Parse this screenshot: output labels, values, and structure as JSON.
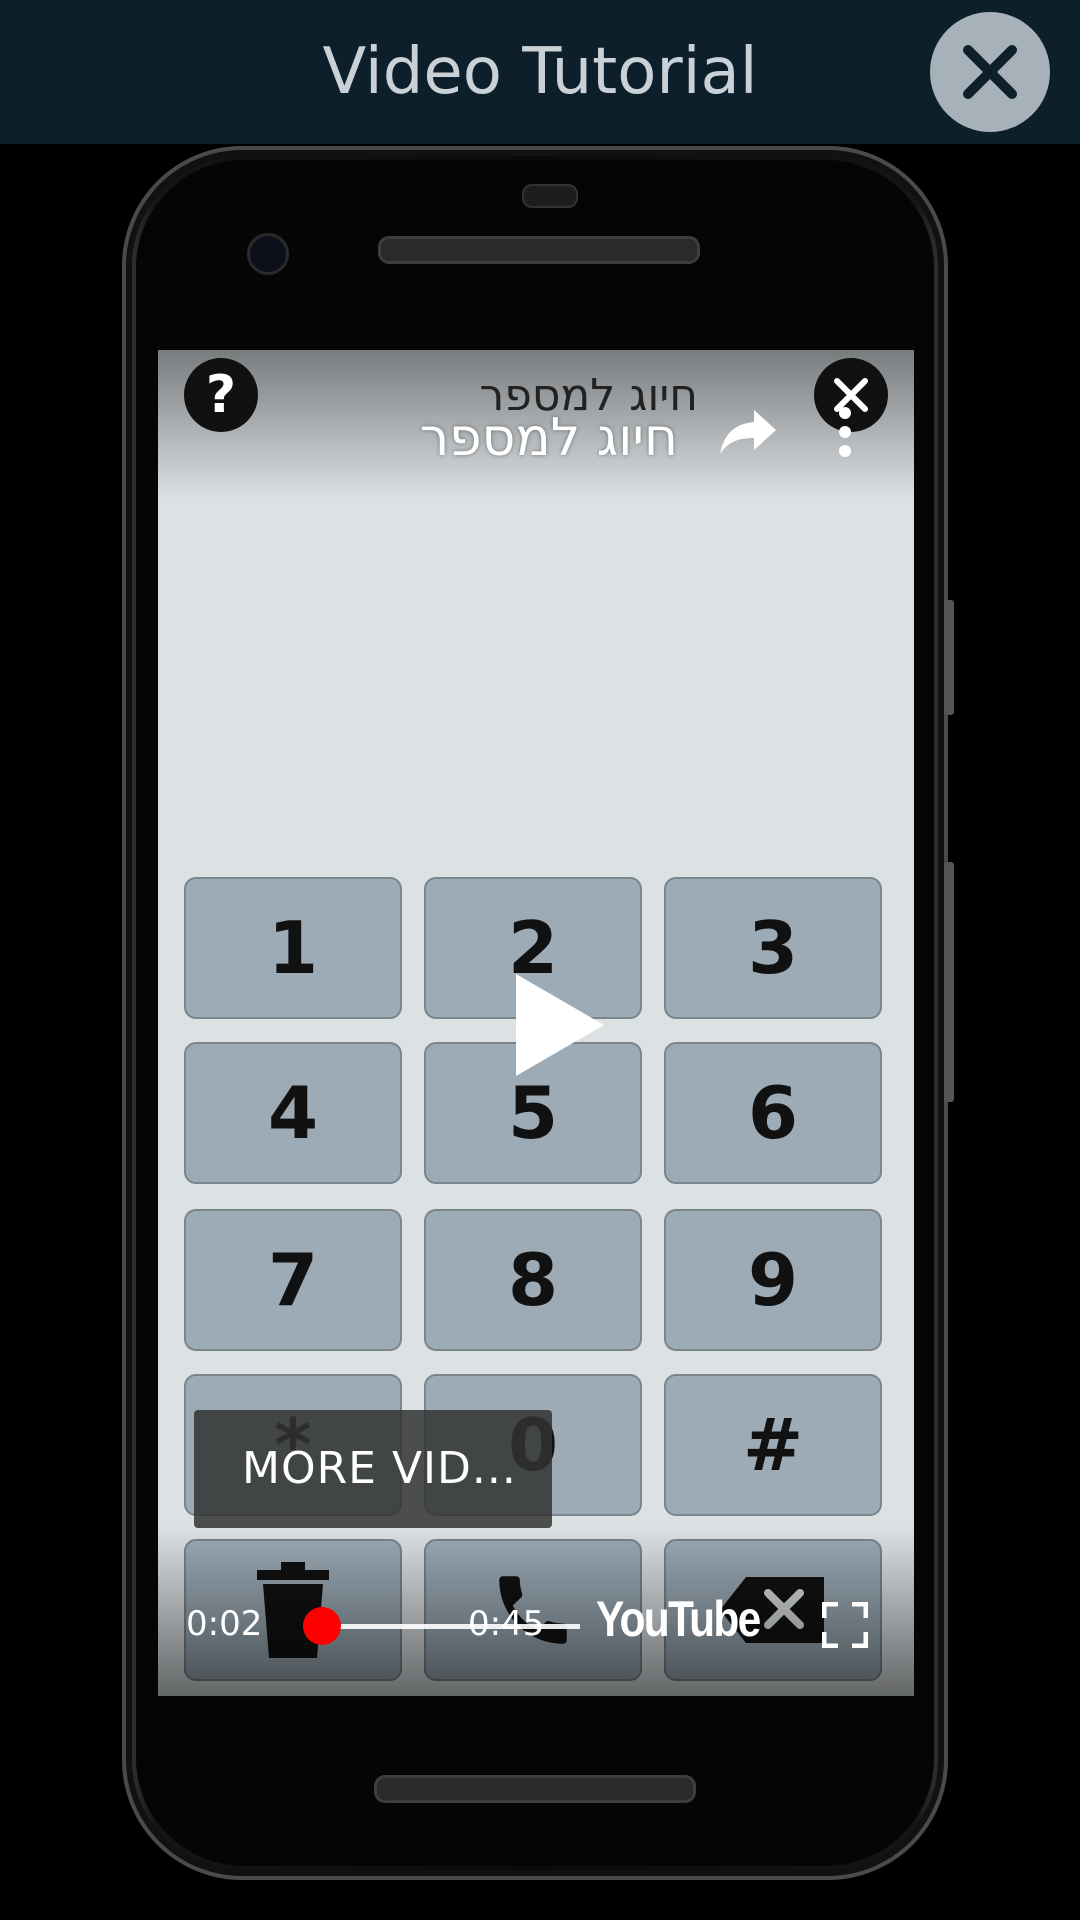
{
  "app_bar": {
    "title": "Video Tutorial",
    "close_icon": "close-icon"
  },
  "video": {
    "app_title": "חיוג למספר",
    "youtube_title": "חיוג למספר",
    "help_label": "?",
    "more_videos_label": "MORE VID...",
    "current_time": "0:02",
    "total_time": "0:45",
    "progress_fraction": 0.044,
    "youtube_logo": "YouTube",
    "icons": {
      "share": "share-icon",
      "more": "more-vert-icon",
      "play": "play-icon",
      "fullscreen": "fullscreen-icon"
    }
  },
  "keypad": {
    "keys": [
      "1",
      "2",
      "3",
      "4",
      "5",
      "6",
      "7",
      "8",
      "9",
      "*",
      "0",
      "#"
    ],
    "bottom_icons": [
      "trash-icon",
      "phone-icon",
      "backspace-icon"
    ]
  },
  "colors": {
    "app_bar_bg": "#0e1f2c",
    "progress": "#ff0000",
    "key_bg": "#9cabb6"
  }
}
